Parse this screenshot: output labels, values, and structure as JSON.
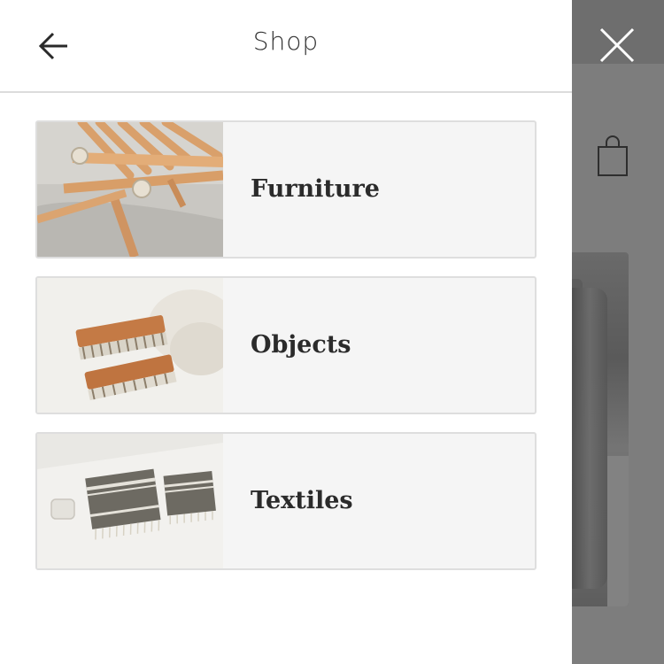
{
  "drawer": {
    "title": "Shop",
    "back_icon": "arrow-left-icon",
    "categories": [
      {
        "label": "Furniture",
        "image": "wooden-chair-photo"
      },
      {
        "label": "Objects",
        "image": "wooden-brushes-photo"
      },
      {
        "label": "Textiles",
        "image": "striped-towels-photo"
      }
    ]
  },
  "background": {
    "close_icon": "close-icon",
    "cart_icon": "shopping-bag-icon"
  },
  "colors": {
    "overlay": "#7d7d7d",
    "card_background": "#f5f5f5",
    "card_border": "#dedede",
    "text": "#2b2b2b"
  }
}
